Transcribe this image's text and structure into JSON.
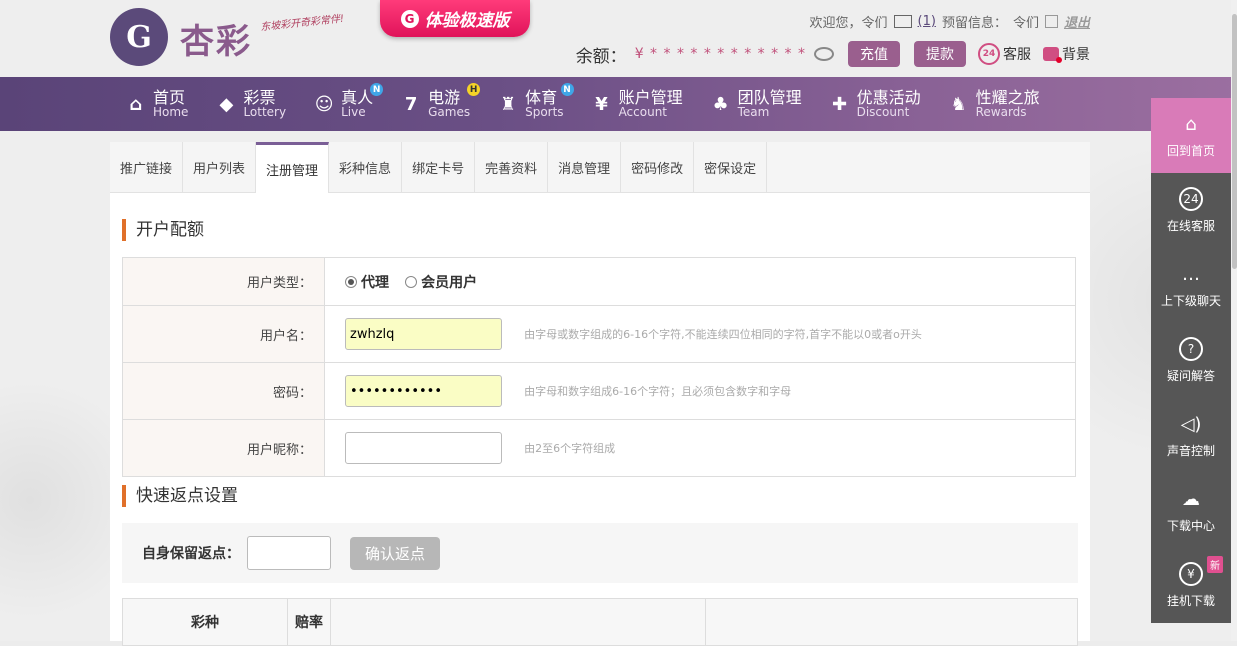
{
  "header": {
    "logo": {
      "mark": "G",
      "text": "杏彩",
      "slogan": "东坡彩开奇彩常伴!"
    },
    "promo": {
      "icon": "G",
      "label": "体验极速版"
    },
    "topbar": {
      "welcome": "欢迎您，令们",
      "mail_count": "(1)",
      "reserved_label": "预留信息：",
      "reserved_value": "令们",
      "logout": "退出"
    },
    "balance": {
      "label": "余额：",
      "value": "¥ * * * * * * * * * * * *",
      "recharge": "充值",
      "withdraw": "提款",
      "service": "客服",
      "background": "背景"
    }
  },
  "nav": [
    {
      "cn": "首页",
      "en": "Home",
      "icon": "⌂",
      "badge": ""
    },
    {
      "cn": "彩票",
      "en": "Lottery",
      "icon": "◆",
      "badge": ""
    },
    {
      "cn": "真人",
      "en": "Live",
      "icon": "☺",
      "badge": "N"
    },
    {
      "cn": "电游",
      "en": "Games",
      "icon": "7",
      "badge": "H"
    },
    {
      "cn": "体育",
      "en": "Sports",
      "icon": "♜",
      "badge": "N"
    },
    {
      "cn": "账户管理",
      "en": "Account",
      "icon": "¥",
      "badge": ""
    },
    {
      "cn": "团队管理",
      "en": "Team",
      "icon": "♣",
      "badge": ""
    },
    {
      "cn": "优惠活动",
      "en": "Discount",
      "icon": "✚",
      "badge": ""
    },
    {
      "cn": "性耀之旅",
      "en": "Rewards",
      "icon": "♞",
      "badge": ""
    }
  ],
  "tabs": [
    "推广链接",
    "用户列表",
    "注册管理",
    "彩种信息",
    "绑定卡号",
    "完善资料",
    "消息管理",
    "密码修改",
    "密保设定"
  ],
  "form": {
    "title": "开户配额",
    "user_type_label": "用户类型：",
    "user_type_options": [
      "代理",
      "会员用户"
    ],
    "username_label": "用户名：",
    "username_value": "zwhzlq",
    "username_hint": "由字母或数字组成的6-16个字符,不能连续四位相同的字符,首字不能以0或者o开头",
    "password_label": "密码：",
    "password_value": "••••••••••••",
    "password_hint": "由字母和数字组成6-16个字符；且必须包含数字和字母",
    "nickname_label": "用户昵称：",
    "nickname_value": "",
    "nickname_hint": "由2至6个字符组成"
  },
  "rebate": {
    "title": "快速返点设置",
    "label": "自身保留返点：",
    "button": "确认返点"
  },
  "odds_table": {
    "headers": [
      "彩种",
      "赔率",
      "",
      ""
    ]
  },
  "sidebar": [
    {
      "label": "回到首页",
      "icon": "⌂"
    },
    {
      "label": "在线客服",
      "icon": "24"
    },
    {
      "label": "上下级聊天",
      "icon": "…"
    },
    {
      "label": "疑问解答",
      "icon": "?"
    },
    {
      "label": "声音控制",
      "icon": "◁)"
    },
    {
      "label": "下载中心",
      "icon": "☁"
    },
    {
      "label": "挂机下载",
      "icon": "¥",
      "badge": "新"
    }
  ]
}
